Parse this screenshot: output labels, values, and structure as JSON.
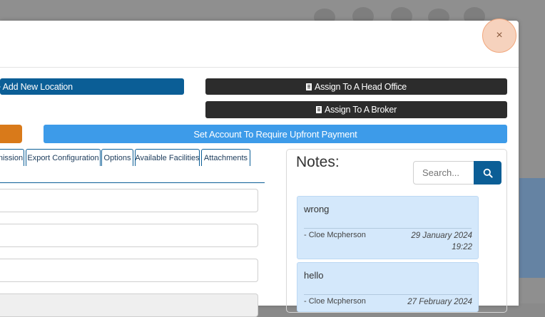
{
  "buttons": {
    "add_location": "+ Add New Location",
    "assign_head_office": "Assign To A Head Office",
    "assign_broker": "Assign To A Broker",
    "upfront_payment": "Set Account To Require Upfront Payment",
    "close": "×"
  },
  "tabs": [
    {
      "label": "nission"
    },
    {
      "label": "Export Configuration"
    },
    {
      "label": "Options"
    },
    {
      "label": "Available Facilities"
    },
    {
      "label": "Attachments"
    }
  ],
  "notes": {
    "title": "Notes:",
    "search_placeholder": "Search...",
    "items": [
      {
        "text": "wrong",
        "author": "- Cloe Mcpherson",
        "date": "29 January 2024",
        "time": "19:22"
      },
      {
        "text": "hello",
        "author": "- Cloe Mcpherson",
        "date": "27 February 2024"
      }
    ]
  },
  "colors": {
    "primary": "#0b5e96",
    "dark": "#2c2c2c",
    "orange": "#d97a1a",
    "sky": "#3d9be9",
    "note_bg": "#d4e8fb"
  }
}
